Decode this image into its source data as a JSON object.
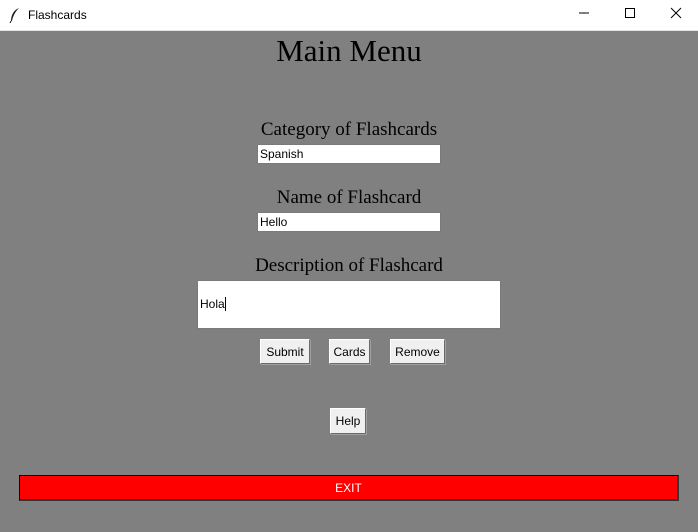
{
  "window": {
    "title": "Flashcards",
    "icon": "feather-icon",
    "controls": [
      "minimize-icon",
      "maximize-icon",
      "close-icon"
    ]
  },
  "main": {
    "heading": "Main Menu",
    "category_label": "Category of Flashcards",
    "category_value": "Spanish",
    "name_label": "Name of Flashcard",
    "name_value": "Hello",
    "description_label": "Description of Flashcard",
    "description_value": "Hola"
  },
  "buttons": {
    "submit": "Submit",
    "cards": "Cards",
    "remove": "Remove",
    "help": "Help",
    "exit": "EXIT"
  },
  "colors": {
    "background": "#808080",
    "exit_button": "#ff0000",
    "exit_text": "#ffffff"
  }
}
